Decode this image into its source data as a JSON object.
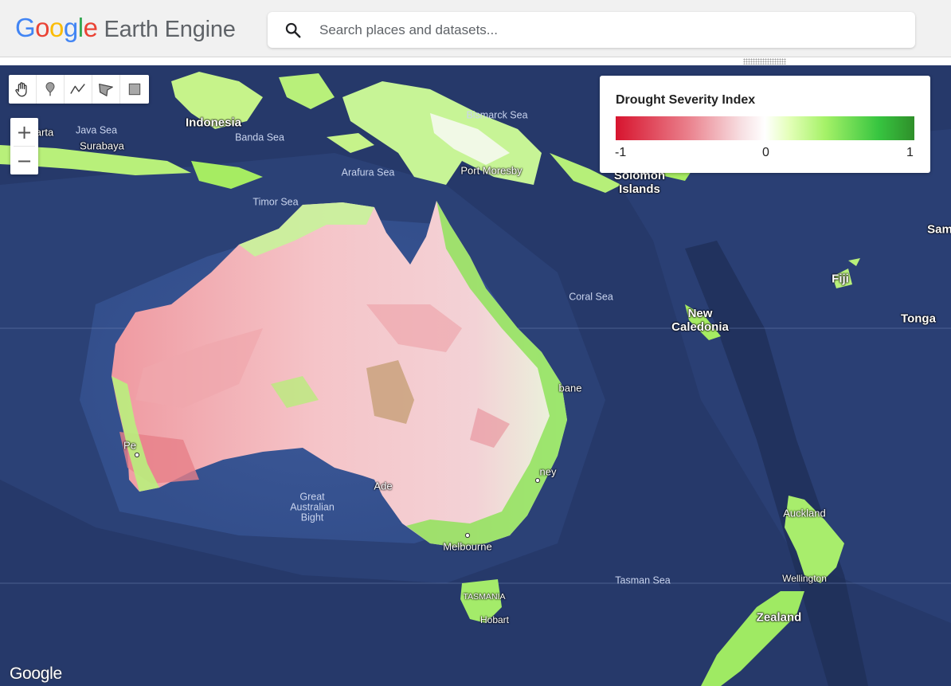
{
  "header": {
    "logo_letters": [
      {
        "ch": "G",
        "color": "#4285f4"
      },
      {
        "ch": "o",
        "color": "#ea4335"
      },
      {
        "ch": "o",
        "color": "#fbbc05"
      },
      {
        "ch": "g",
        "color": "#4285f4"
      },
      {
        "ch": "l",
        "color": "#34a853"
      },
      {
        "ch": "e",
        "color": "#ea4335"
      }
    ],
    "product_name": "Earth Engine",
    "search_placeholder": "Search places and datasets..."
  },
  "map": {
    "draw_tools": [
      "pan-hand-icon",
      "marker-icon",
      "line-icon",
      "polygon-icon",
      "rectangle-icon"
    ],
    "zoom_in": "+",
    "zoom_out": "−",
    "attribution": "Google",
    "labels": {
      "java_sea": "Java Sea",
      "surabaya": "Surabaya",
      "jakarta_partial": "arta",
      "indonesia": "Indonesia",
      "banda_sea": "Banda Sea",
      "bismarck_sea": "Bismarck Sea",
      "arafura_sea": "Arafura Sea",
      "port_moresby": "Port Moresby",
      "solomon_islands": "Solomon\nIslands",
      "timor_sea": "Timor Sea",
      "samoa_partial": "Sam",
      "fiji": "Fiji",
      "coral_sea": "Coral Sea",
      "new_caledonia": "New\nCaledonia",
      "tonga": "Tonga",
      "brisbane_partial": "bane",
      "perth_partial": "Pe",
      "sydney_partial": "ney",
      "adelaide_partial": "Ade",
      "great_australian_bight": "Great\nAustralian\nBight",
      "melbourne": "Melbourne",
      "auckland": "Auckland",
      "wellington": "Wellington",
      "tasman_sea": "Tasman Sea",
      "tasmania": "TASMANIA",
      "hobart": "Hobart",
      "new_zealand_partial": "Zealand"
    }
  },
  "legend": {
    "title": "Drought Severity Index",
    "colors": [
      "#d7142e",
      "#ffffff",
      "#2f8f2a"
    ],
    "min_label": "-1",
    "mid_label": "0",
    "max_label": "1"
  }
}
